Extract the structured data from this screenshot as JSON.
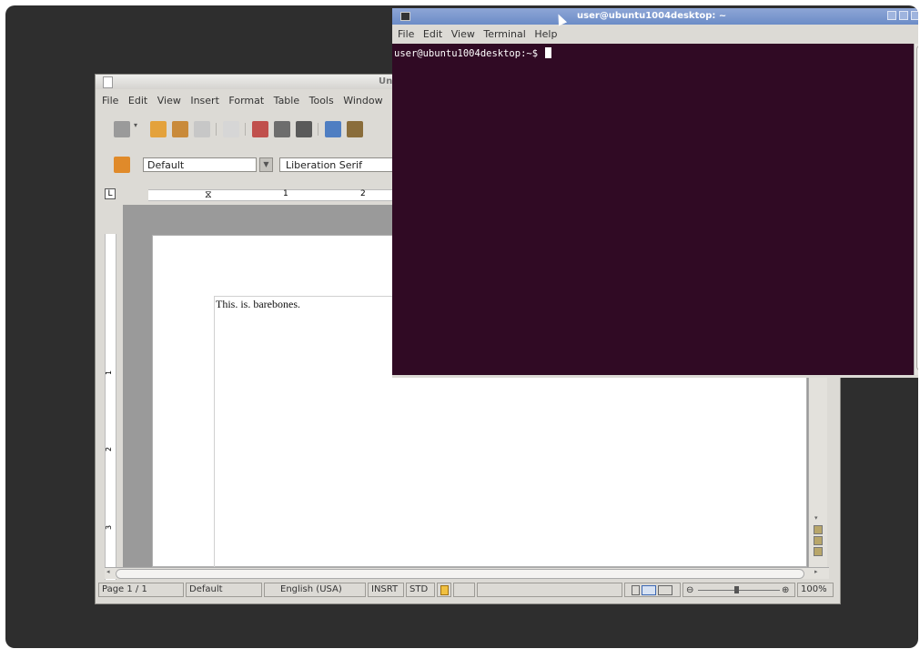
{
  "writer": {
    "title": "Untit",
    "menu": [
      "File",
      "Edit",
      "View",
      "Insert",
      "Format",
      "Table",
      "Tools",
      "Window"
    ],
    "paragraph_style": "Default",
    "font_name": "Liberation Serif",
    "ruler_marks": [
      "1",
      "2"
    ],
    "vruler_marks": [
      "1",
      "2",
      "3"
    ],
    "document_text": "This. is. barebones.",
    "status": {
      "page": "Page 1 / 1",
      "page_style": "Default",
      "language": "English (USA)",
      "insert_mode": "INSRT",
      "selection_mode": "STD",
      "zoom": "100%"
    }
  },
  "terminal": {
    "title": "user@ubuntu1004desktop: ~",
    "menu": [
      "File",
      "Edit",
      "View",
      "Terminal",
      "Help"
    ],
    "prompt": "user@ubuntu1004desktop:~$ ",
    "background": "#300a24"
  },
  "colors": {
    "desktop": "#2e2e2e",
    "window_chrome": "#dcdad5",
    "terminal_titlebar": "#7b97cf"
  }
}
